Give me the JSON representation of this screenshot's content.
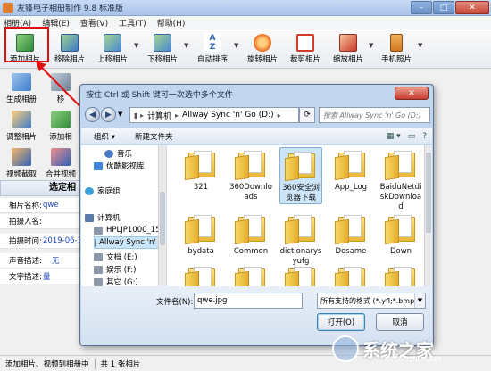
{
  "app": {
    "title": "友锋电子相册制作 9.8 标准版",
    "menu": [
      "相册(A)",
      "编辑(E)",
      "查看(V)",
      "工具(T)",
      "帮助(H)"
    ],
    "toolbar": [
      {
        "label": "添加相片",
        "icon": "add-photo-icon",
        "color": "#2f8a3a"
      },
      {
        "label": "移除相片",
        "icon": "remove-photo-icon",
        "color": "#3e7bc9"
      },
      {
        "label": "上移相片",
        "icon": "move-up-icon",
        "color": "#4a8ad0"
      },
      {
        "label": "下移相片",
        "icon": "move-down-icon",
        "color": "#4a8ad0"
      },
      {
        "label": "自动排序",
        "icon": "sort-az-icon",
        "color": "#3264b4"
      },
      {
        "label": "旋转相片",
        "icon": "rotate-icon",
        "color": "#e86b1e"
      },
      {
        "label": "裁剪相片",
        "icon": "crop-icon",
        "color": "#d23a2a"
      },
      {
        "label": "缩放相片",
        "icon": "resize-icon",
        "color": "#c9352a"
      },
      {
        "label": "手机照片",
        "icon": "phone-icon",
        "color": "#d0771c"
      }
    ],
    "side_tools": [
      {
        "label": "生成相册",
        "icon": "generate-album-icon"
      },
      {
        "label": "移",
        "icon": "move-icon"
      },
      {
        "label": "调整相片",
        "icon": "adjust-photo-icon"
      },
      {
        "label": "添加相",
        "icon": "add-icon"
      },
      {
        "label": "视频截取",
        "icon": "video-capture-icon"
      },
      {
        "label": "合并视频",
        "icon": "merge-video-icon"
      }
    ],
    "panel": {
      "header": "选定相",
      "rows": [
        {
          "key": "相片名称:",
          "value": "qwe"
        },
        {
          "key": "拍摄人名:",
          "value": ""
        },
        {
          "key": "拍摄时间:",
          "value": "2019-06-19"
        },
        {
          "key": "声音描述:",
          "value": "无"
        },
        {
          "key": "文字描述:",
          "value": "量"
        }
      ]
    },
    "status": {
      "left": "添加相片、视频到相册中",
      "right": "共 1 张相片"
    }
  },
  "dialog": {
    "title": "按住 Ctrl 或 Shift 键可一次选中多个文件",
    "close": "✕",
    "breadcrumb": [
      "计算机",
      "Allway Sync 'n' Go (D:)"
    ],
    "search_placeholder": "搜索 Allway Sync 'n' Go (D:)",
    "commands": {
      "organize": "组织 ▾",
      "new_folder": "新建文件夹"
    },
    "nav": [
      {
        "label": "音乐",
        "type": "music",
        "color": "#4b78c3"
      },
      {
        "label": "优酷影视库",
        "type": "video",
        "color": "#3e86d9"
      },
      {
        "label": "家庭组",
        "type": "homegroup",
        "color": "#3aa0d8"
      },
      {
        "label": "计算机",
        "type": "computer",
        "color": "#5a7aa8"
      },
      {
        "label": "HPLJP1000_150",
        "type": "drive",
        "color": "#8d98a8"
      },
      {
        "label": "Allway Sync 'n' G",
        "type": "drive",
        "color": "#6f7d91"
      },
      {
        "label": "文档 (E:)",
        "type": "drive",
        "color": "#8d98a8"
      },
      {
        "label": "娱乐 (F:)",
        "type": "drive",
        "color": "#8d98a8"
      },
      {
        "label": "其它 (G:)",
        "type": "drive",
        "color": "#8d98a8"
      }
    ],
    "files": [
      {
        "name": "321"
      },
      {
        "name": "360Downloads"
      },
      {
        "name": "360安全浏览器下载"
      },
      {
        "name": "App_Log"
      },
      {
        "name": "BaiduNetdiskDownload"
      },
      {
        "name": "bydata"
      },
      {
        "name": "Common"
      },
      {
        "name": "dictionarysyufg"
      },
      {
        "name": "Dosame"
      },
      {
        "name": "Down"
      },
      {
        "name": ""
      },
      {
        "name": ""
      },
      {
        "name": ""
      },
      {
        "name": ""
      },
      {
        "name": ""
      }
    ],
    "filename_label": "文件名(N):",
    "filename_value": "qwe.jpg",
    "filter_value": "所有支持的格式 (*.yfl;*.bmp;*.j",
    "open_label": "打开(O)",
    "cancel_label": "取消"
  },
  "watermark": {
    "text": "系统之家",
    "url": "XITONGZHIJIA.NET"
  }
}
